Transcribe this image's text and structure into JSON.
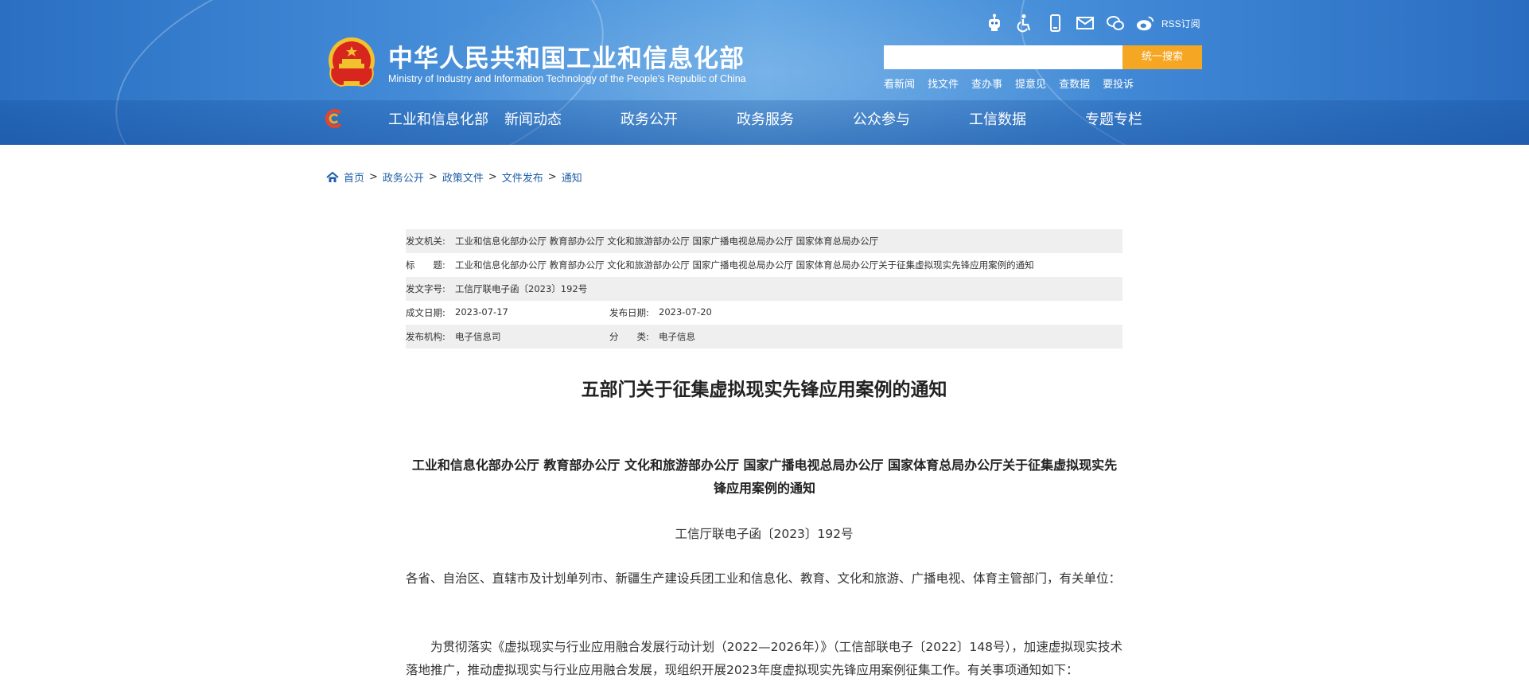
{
  "header": {
    "title": "中华人民共和国工业和信息化部",
    "subtitle": "Ministry of Industry and Information Technology of the People's Republic of China",
    "tools": [
      {
        "icon": "robot-assistant-icon"
      },
      {
        "icon": "accessibility-icon"
      },
      {
        "icon": "mobile-phone-icon"
      },
      {
        "icon": "mail-icon"
      },
      {
        "icon": "wechat-icon"
      },
      {
        "icon": "weibo-icon"
      }
    ],
    "rss_label": "RSS订阅",
    "search": {
      "placeholder": "",
      "button_label": "统一搜索"
    },
    "quick_links": [
      "看新闻",
      "找文件",
      "查办事",
      "提意见",
      "查数据",
      "要投诉"
    ],
    "nav": [
      "工业和信息化部",
      "新闻动态",
      "政务公开",
      "政务服务",
      "公众参与",
      "工信数据",
      "专题专栏"
    ]
  },
  "breadcrumb": [
    "首页",
    "政务公开",
    "政策文件",
    "文件发布",
    "通知"
  ],
  "info": {
    "issuer_label": "发文机关:",
    "issuer": "工业和信息化部办公厅 教育部办公厅 文化和旅游部办公厅 国家广播电视总局办公厅 国家体育总局办公厅",
    "title_label": "标　　题:",
    "title": "工业和信息化部办公厅 教育部办公厅 文化和旅游部办公厅 国家广播电视总局办公厅 国家体育总局办公厅关于征集虚拟现实先锋应用案例的通知",
    "number_label": "发文字号:",
    "number": "工信厅联电子函〔2023〕192号",
    "written_label": "成文日期:",
    "written": "2023-07-17",
    "published_label": "发布日期:",
    "published": "2023-07-20",
    "org_label": "发布机构:",
    "org": "电子信息司",
    "category_label": "分　　类:",
    "category": "电子信息"
  },
  "article": {
    "title": "五部门关于征集虚拟现实先锋应用案例的通知",
    "heading": "工业和信息化部办公厅  教育部办公厅  文化和旅游部办公厅  国家广播电视总局办公厅  国家体育总局办公厅关于征集虚拟现实先锋应用案例的通知",
    "doc_number": "工信厅联电子函〔2023〕192号",
    "addressee": "各省、自治区、直辖市及计划单列市、新疆生产建设兵团工业和信息化、教育、文化和旅游、广播电视、体育主管部门，有关单位：",
    "body": "为贯彻落实《虚拟现实与行业应用融合发展行动计划（2022—2026年）》（工信部联电子〔2022〕148号），加速虚拟现实技术落地推广，推动虚拟现实与行业应用融合发展，现组织开展2023年度虚拟现实先锋应用案例征集工作。有关事项通知如下："
  }
}
